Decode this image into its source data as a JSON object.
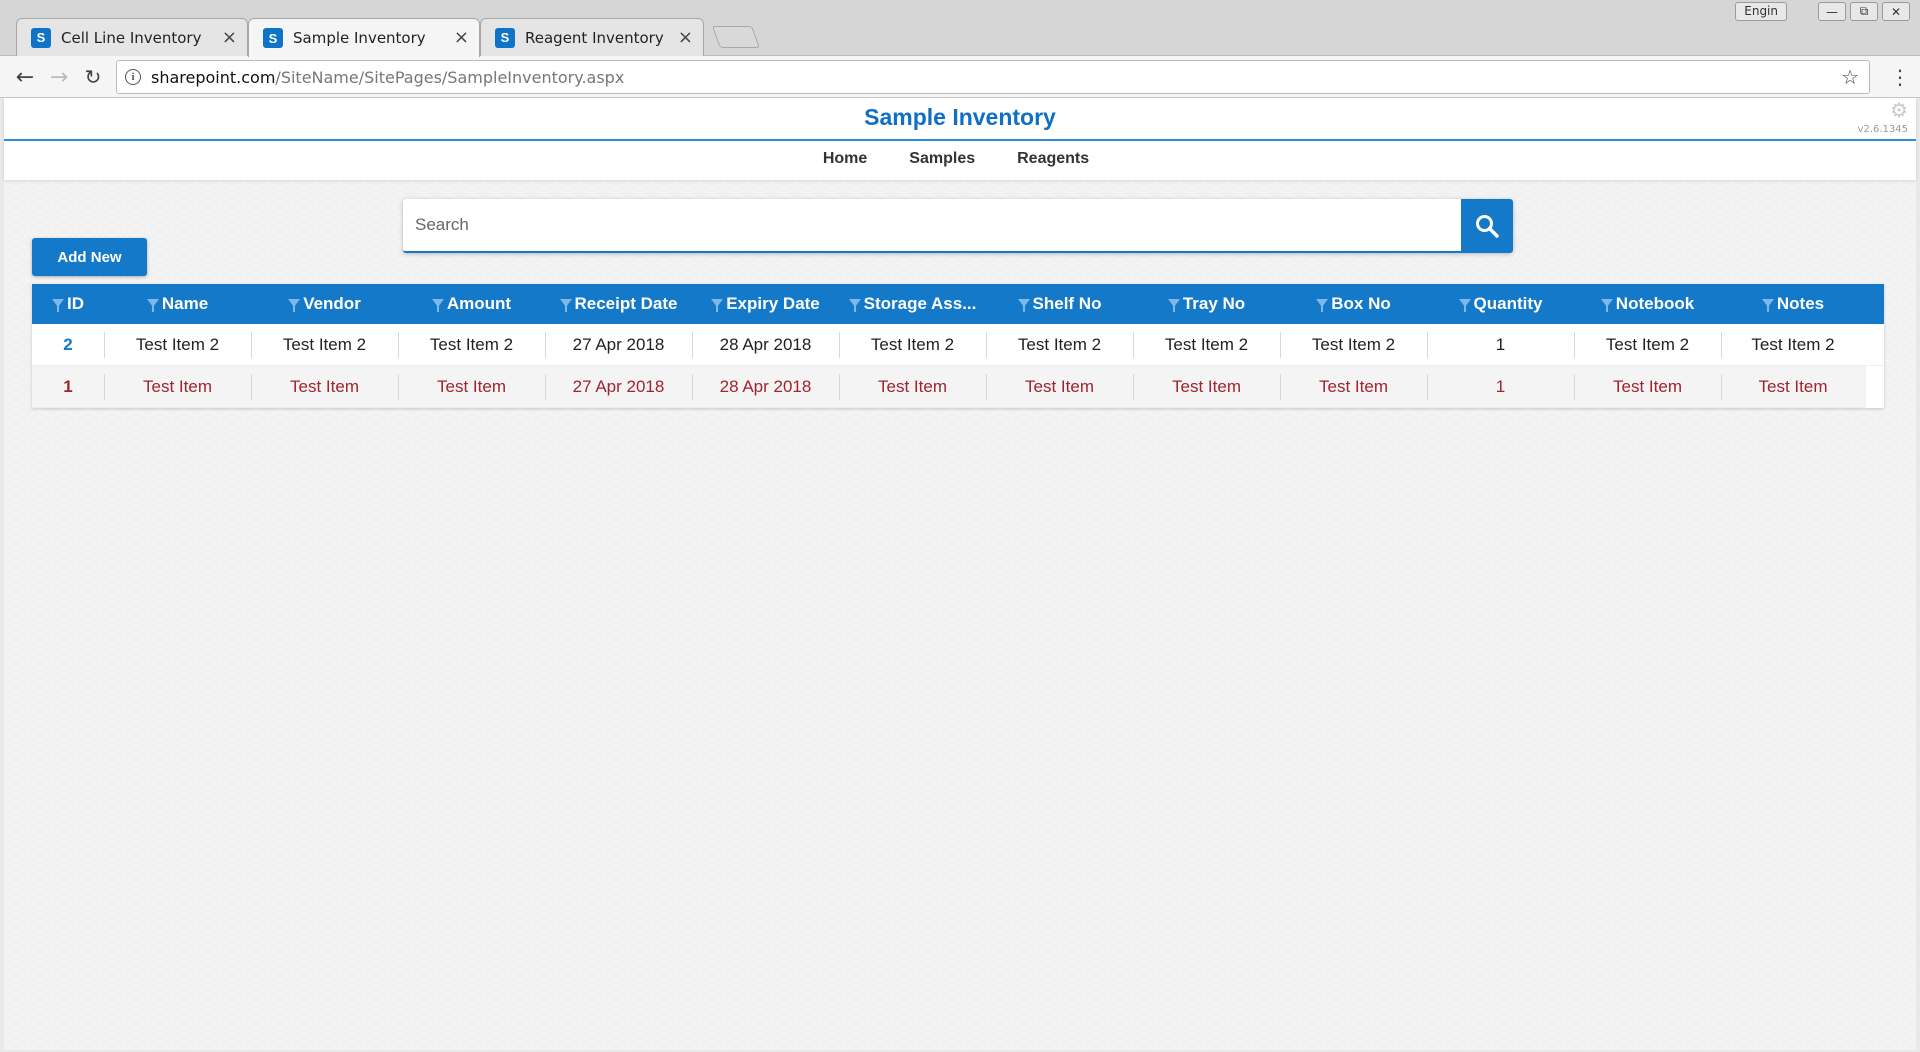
{
  "browser": {
    "tabs": [
      {
        "label": "Cell Line Inventory",
        "icon": "sharepoint-icon",
        "active": false
      },
      {
        "label": "Sample Inventory",
        "icon": "sharepoint-icon",
        "active": true
      },
      {
        "label": "Reagent Inventory",
        "icon": "sharepoint-icon",
        "active": false
      }
    ],
    "tab_icon_glyph": "S",
    "tab_close_glyph": "×",
    "language_badge": "Engin",
    "url_host": "sharepoint.com",
    "url_path": "/SiteName/SitePages/SampleInventory.aspx"
  },
  "site": {
    "title": "Sample Inventory",
    "version": "v2.6.1345",
    "nav": [
      "Home",
      "Samples",
      "Reagents"
    ]
  },
  "search": {
    "placeholder": "Search",
    "value": ""
  },
  "actions": {
    "add_new_label": "Add New"
  },
  "table": {
    "columns": [
      "ID",
      "Name",
      "Vendor",
      "Amount",
      "Receipt Date",
      "Expiry Date",
      "Storage Ass...",
      "Shelf No",
      "Tray No",
      "Box No",
      "Quantity",
      "Notebook",
      "Notes"
    ],
    "rows": [
      [
        "2",
        "Test Item 2",
        "Test Item 2",
        "Test Item 2",
        "27 Apr 2018",
        "28 Apr 2018",
        "Test Item 2",
        "Test Item 2",
        "Test Item 2",
        "Test Item 2",
        "1",
        "Test Item 2",
        "Test Item 2"
      ],
      [
        "1",
        "Test Item",
        "Test Item",
        "Test Item",
        "27 Apr 2018",
        "28 Apr 2018",
        "Test Item",
        "Test Item",
        "Test Item",
        "Test Item",
        "1",
        "Test Item",
        "Test Item"
      ]
    ]
  },
  "colors": {
    "accent": "#1579c9",
    "title": "#0e6fc4",
    "expired_row_text": "#a1232e"
  }
}
